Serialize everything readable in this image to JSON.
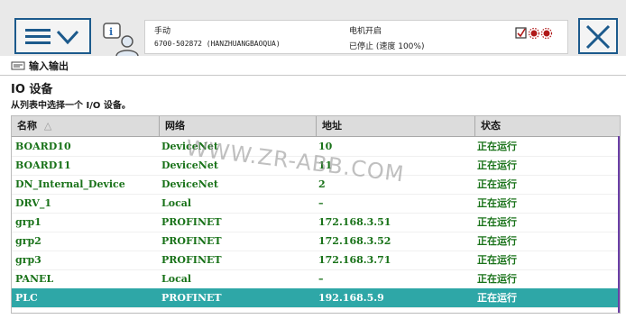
{
  "status": {
    "mode": "手动",
    "system": "6700-502872 (HANZHUANGBAOQUA)",
    "motor": "电机开启",
    "state": "已停止 (速度 100%)"
  },
  "window": {
    "title": "输入输出"
  },
  "page": {
    "title": "IO 设备",
    "subtitle": "从列表中选择一个 I/O 设备。"
  },
  "table": {
    "headers": [
      "名称",
      "网络",
      "地址",
      "状态"
    ],
    "sort_indicator": "△",
    "rows": [
      [
        "BOARD10",
        "DeviceNet",
        "10",
        "正在运行"
      ],
      [
        "BOARD11",
        "DeviceNet",
        "11",
        "正在运行"
      ],
      [
        "DN_Internal_Device",
        "DeviceNet",
        "2",
        "正在运行"
      ],
      [
        "DRV_1",
        "Local",
        "–",
        "正在运行"
      ],
      [
        "grp1",
        "PROFINET",
        "172.168.3.51",
        "正在运行"
      ],
      [
        "grp2",
        "PROFINET",
        "172.168.3.52",
        "正在运行"
      ],
      [
        "grp3",
        "PROFINET",
        "172.168.3.71",
        "正在运行"
      ],
      [
        "PANEL",
        "Local",
        "–",
        "正在运行"
      ],
      [
        "PLC",
        "PROFINET",
        "192.168.5.9",
        "正在运行"
      ]
    ],
    "selected_row": 8
  },
  "watermark": "WWW.ZR-ABB.COM",
  "colors": {
    "accent": "#1c5a8c",
    "row_text": "#197219",
    "selected": "#2ea7a7",
    "scrollbar": "#6b3fa6"
  },
  "icons": {
    "menu": "hamburger-chevron-icon",
    "robot": "robot-info-icon",
    "status": "status-flags-icon",
    "close": "close-icon",
    "io": "io-window-icon"
  }
}
